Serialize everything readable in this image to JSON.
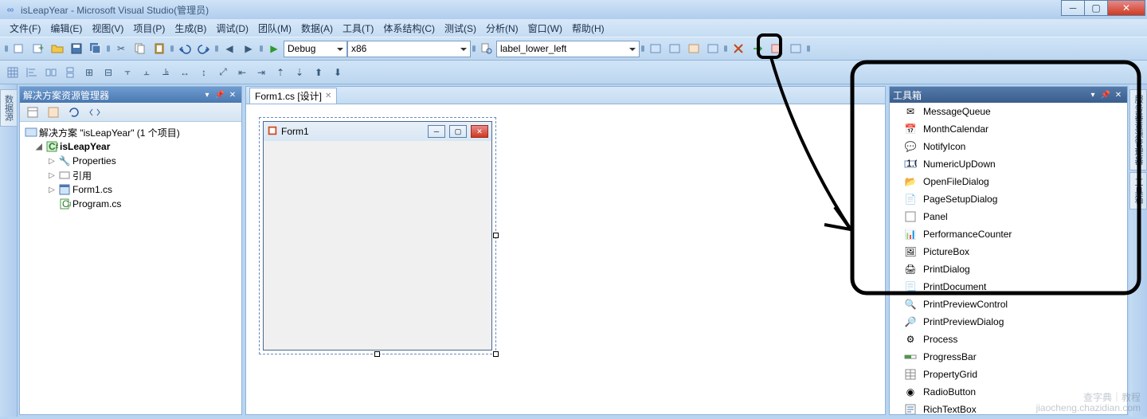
{
  "titlebar": {
    "text": "isLeapYear - Microsoft Visual Studio(管理员)"
  },
  "menu": [
    "文件(F)",
    "编辑(E)",
    "视图(V)",
    "项目(P)",
    "生成(B)",
    "调试(D)",
    "团队(M)",
    "数据(A)",
    "工具(T)",
    "体系结构(C)",
    "测试(S)",
    "分析(N)",
    "窗口(W)",
    "帮助(H)"
  ],
  "toolbar": {
    "config": "Debug",
    "platform": "x86",
    "search": "label_lower_left"
  },
  "solution_explorer": {
    "title": "解决方案资源管理器",
    "root": "解决方案 \"isLeapYear\" (1 个项目)",
    "project": "isLeapYear",
    "nodes": [
      "Properties",
      "引用",
      "Form1.cs",
      "Program.cs"
    ]
  },
  "vtab_left": {
    "label": "数据源"
  },
  "doc_tab": {
    "label": "Form1.cs [设计]"
  },
  "form": {
    "title": "Form1"
  },
  "toolbox": {
    "title": "工具箱",
    "items": [
      "MessageQueue",
      "MonthCalendar",
      "NotifyIcon",
      "NumericUpDown",
      "OpenFileDialog",
      "PageSetupDialog",
      "Panel",
      "PerformanceCounter",
      "PictureBox",
      "PrintDialog",
      "PrintDocument",
      "PrintPreviewControl",
      "PrintPreviewDialog",
      "Process",
      "ProgressBar",
      "PropertyGrid",
      "RadioButton",
      "RichTextBox"
    ]
  },
  "vtab_right": {
    "label1": "服务器资源管理器",
    "label2": "工具箱"
  },
  "watermark": {
    "line1": "查字典｜教程",
    "line2": "jiaocheng.chazidian.com"
  }
}
